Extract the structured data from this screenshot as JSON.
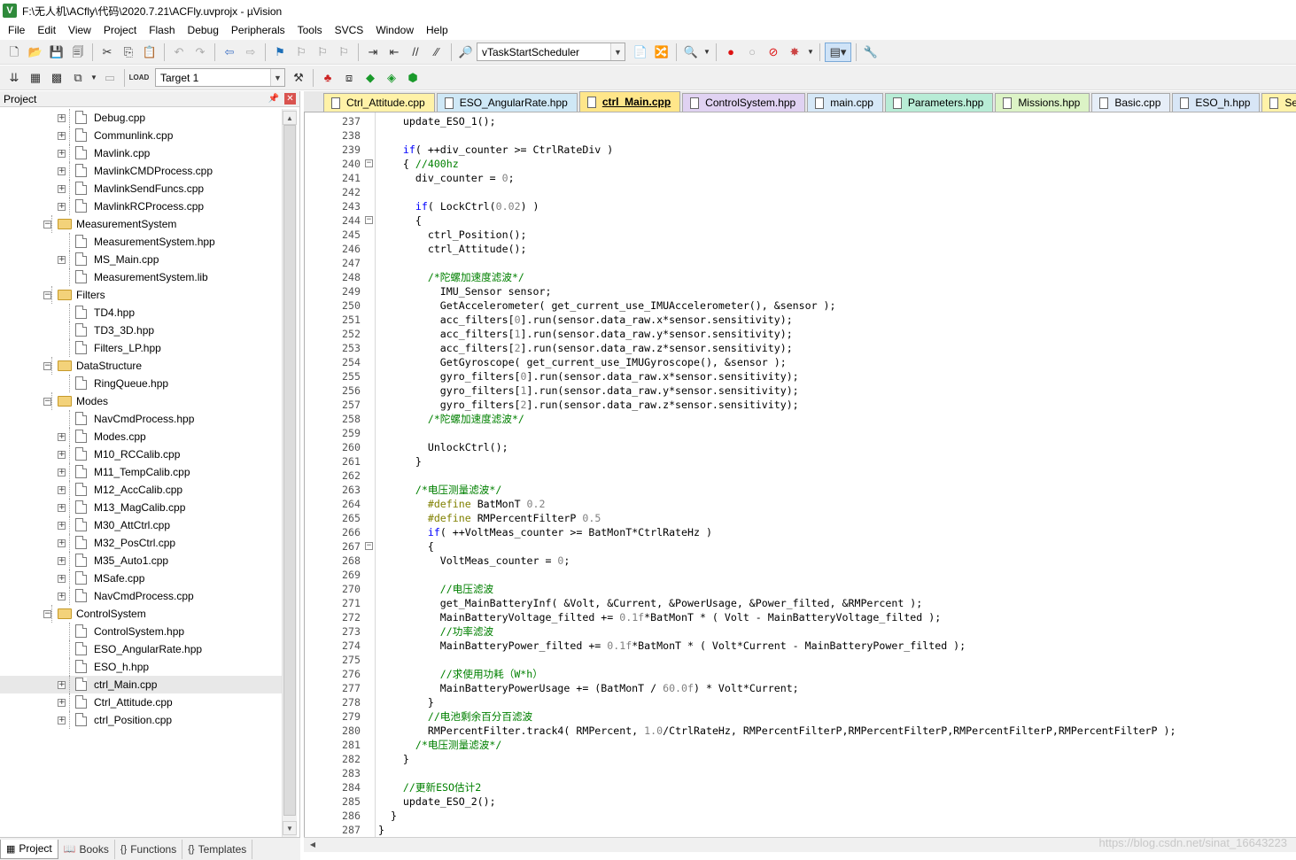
{
  "window": {
    "title": "F:\\无人机\\ACfly\\代码\\2020.7.21\\ACFly.uvprojx - µVision"
  },
  "menu": [
    "File",
    "Edit",
    "View",
    "Project",
    "Flash",
    "Debug",
    "Peripherals",
    "Tools",
    "SVCS",
    "Window",
    "Help"
  ],
  "toolbar": {
    "function_combo": "vTaskStartScheduler",
    "target_combo": "Target 1"
  },
  "project_panel": {
    "title": "Project",
    "tree": [
      {
        "label": "Debug.cpp",
        "type": "file",
        "level": 2,
        "expand": "+"
      },
      {
        "label": "Communlink.cpp",
        "type": "file",
        "level": 2,
        "expand": "+"
      },
      {
        "label": "Mavlink.cpp",
        "type": "file",
        "level": 2,
        "expand": "+"
      },
      {
        "label": "MavlinkCMDProcess.cpp",
        "type": "file",
        "level": 2,
        "expand": "+"
      },
      {
        "label": "MavlinkSendFuncs.cpp",
        "type": "file",
        "level": 2,
        "expand": "+"
      },
      {
        "label": "MavlinkRCProcess.cpp",
        "type": "file",
        "level": 2,
        "expand": "+"
      },
      {
        "label": "MeasurementSystem",
        "type": "folder",
        "level": 1,
        "expand": "-"
      },
      {
        "label": "MeasurementSystem.hpp",
        "type": "file",
        "level": 2,
        "expand": ""
      },
      {
        "label": "MS_Main.cpp",
        "type": "file",
        "level": 2,
        "expand": "+"
      },
      {
        "label": "MeasurementSystem.lib",
        "type": "file",
        "level": 2,
        "expand": ""
      },
      {
        "label": "Filters",
        "type": "folder",
        "level": 1,
        "expand": "-"
      },
      {
        "label": "TD4.hpp",
        "type": "file",
        "level": 2,
        "expand": ""
      },
      {
        "label": "TD3_3D.hpp",
        "type": "file",
        "level": 2,
        "expand": ""
      },
      {
        "label": "Filters_LP.hpp",
        "type": "file",
        "level": 2,
        "expand": ""
      },
      {
        "label": "DataStructure",
        "type": "folder",
        "level": 1,
        "expand": "-"
      },
      {
        "label": "RingQueue.hpp",
        "type": "file",
        "level": 2,
        "expand": ""
      },
      {
        "label": "Modes",
        "type": "folder",
        "level": 1,
        "expand": "-"
      },
      {
        "label": "NavCmdProcess.hpp",
        "type": "file",
        "level": 2,
        "expand": ""
      },
      {
        "label": "Modes.cpp",
        "type": "file",
        "level": 2,
        "expand": "+"
      },
      {
        "label": "M10_RCCalib.cpp",
        "type": "file",
        "level": 2,
        "expand": "+"
      },
      {
        "label": "M11_TempCalib.cpp",
        "type": "file",
        "level": 2,
        "expand": "+"
      },
      {
        "label": "M12_AccCalib.cpp",
        "type": "file",
        "level": 2,
        "expand": "+"
      },
      {
        "label": "M13_MagCalib.cpp",
        "type": "file",
        "level": 2,
        "expand": "+"
      },
      {
        "label": "M30_AttCtrl.cpp",
        "type": "file",
        "level": 2,
        "expand": "+"
      },
      {
        "label": "M32_PosCtrl.cpp",
        "type": "file",
        "level": 2,
        "expand": "+"
      },
      {
        "label": "M35_Auto1.cpp",
        "type": "file",
        "level": 2,
        "expand": "+"
      },
      {
        "label": "MSafe.cpp",
        "type": "file",
        "level": 2,
        "expand": "+"
      },
      {
        "label": "NavCmdProcess.cpp",
        "type": "file",
        "level": 2,
        "expand": "+"
      },
      {
        "label": "ControlSystem",
        "type": "folder",
        "level": 1,
        "expand": "-"
      },
      {
        "label": "ControlSystem.hpp",
        "type": "file",
        "level": 2,
        "expand": ""
      },
      {
        "label": "ESO_AngularRate.hpp",
        "type": "file",
        "level": 2,
        "expand": ""
      },
      {
        "label": "ESO_h.hpp",
        "type": "file",
        "level": 2,
        "expand": ""
      },
      {
        "label": "ctrl_Main.cpp",
        "type": "file",
        "level": 2,
        "expand": "+",
        "selected": true
      },
      {
        "label": "Ctrl_Attitude.cpp",
        "type": "file",
        "level": 2,
        "expand": "+"
      },
      {
        "label": "ctrl_Position.cpp",
        "type": "file",
        "level": 2,
        "expand": "+"
      }
    ]
  },
  "bottom_tabs": [
    {
      "label": "Project",
      "icon": "project-icon",
      "active": true
    },
    {
      "label": "Books",
      "icon": "books-icon",
      "active": false
    },
    {
      "label": "Functions",
      "icon": "functions-icon",
      "active": false
    },
    {
      "label": "Templates",
      "icon": "templates-icon",
      "active": false
    }
  ],
  "editor_tabs": [
    {
      "label": "Ctrl_Attitude.cpp",
      "color": "#fff2a8",
      "active": false
    },
    {
      "label": "ESO_AngularRate.hpp",
      "color": "#cfe8f6",
      "active": false
    },
    {
      "label": "ctrl_Main.cpp",
      "color": "#ffe68a",
      "active": true
    },
    {
      "label": "ControlSystem.hpp",
      "color": "#e0d2f2",
      "active": false
    },
    {
      "label": "main.cpp",
      "color": "#d6e8f7",
      "active": false
    },
    {
      "label": "Parameters.hpp",
      "color": "#b8ecd6",
      "active": false
    },
    {
      "label": "Missions.hpp",
      "color": "#dcf3c6",
      "active": false
    },
    {
      "label": "Basic.cpp",
      "color": "#e6eef8",
      "active": false
    },
    {
      "label": "ESO_h.hpp",
      "color": "#d8e6f6",
      "active": false
    },
    {
      "label": "Ser",
      "color": "#fff2a8",
      "active": false
    }
  ],
  "code": [
    {
      "n": "237",
      "fold": "",
      "s": [
        [
          "",
          "    update_ESO_1();"
        ]
      ]
    },
    {
      "n": "238",
      "fold": "",
      "s": []
    },
    {
      "n": "239",
      "fold": "",
      "s": [
        [
          "",
          "    "
        ],
        [
          "kw",
          "if"
        ],
        [
          "",
          "( ++div_counter >= CtrlRateDiv )"
        ]
      ]
    },
    {
      "n": "240",
      "fold": "-",
      "s": [
        [
          "",
          "    { "
        ],
        [
          "cm",
          "//400hz"
        ]
      ]
    },
    {
      "n": "241",
      "fold": "",
      "s": [
        [
          "",
          "      div_counter = "
        ],
        [
          "nm",
          "0"
        ],
        [
          "",
          ";"
        ]
      ]
    },
    {
      "n": "242",
      "fold": "",
      "s": []
    },
    {
      "n": "243",
      "fold": "",
      "s": [
        [
          "",
          "      "
        ],
        [
          "kw",
          "if"
        ],
        [
          "",
          "( LockCtrl("
        ],
        [
          "nm",
          "0.02"
        ],
        [
          "",
          ") )"
        ]
      ]
    },
    {
      "n": "244",
      "fold": "-",
      "s": [
        [
          "",
          "      {"
        ]
      ]
    },
    {
      "n": "245",
      "fold": "",
      "s": [
        [
          "",
          "        ctrl_Position();"
        ]
      ]
    },
    {
      "n": "246",
      "fold": "",
      "s": [
        [
          "",
          "        ctrl_Attitude();"
        ]
      ]
    },
    {
      "n": "247",
      "fold": "",
      "s": []
    },
    {
      "n": "248",
      "fold": "",
      "s": [
        [
          "cm",
          "        /*陀螺加速度滤波*/"
        ]
      ]
    },
    {
      "n": "249",
      "fold": "",
      "s": [
        [
          "",
          "          IMU_Sensor sensor;"
        ]
      ]
    },
    {
      "n": "250",
      "fold": "",
      "s": [
        [
          "",
          "          GetAccelerometer( get_current_use_IMUAccelerometer(), &sensor );"
        ]
      ]
    },
    {
      "n": "251",
      "fold": "",
      "s": [
        [
          "",
          "          acc_filters["
        ],
        [
          "nm",
          "0"
        ],
        [
          "",
          "].run(sensor.data_raw.x*sensor.sensitivity);"
        ]
      ]
    },
    {
      "n": "252",
      "fold": "",
      "s": [
        [
          "",
          "          acc_filters["
        ],
        [
          "nm",
          "1"
        ],
        [
          "",
          "].run(sensor.data_raw.y*sensor.sensitivity);"
        ]
      ]
    },
    {
      "n": "253",
      "fold": "",
      "s": [
        [
          "",
          "          acc_filters["
        ],
        [
          "nm",
          "2"
        ],
        [
          "",
          "].run(sensor.data_raw.z*sensor.sensitivity);"
        ]
      ]
    },
    {
      "n": "254",
      "fold": "",
      "s": [
        [
          "",
          "          GetGyroscope( get_current_use_IMUGyroscope(), &sensor );"
        ]
      ]
    },
    {
      "n": "255",
      "fold": "",
      "s": [
        [
          "",
          "          gyro_filters["
        ],
        [
          "nm",
          "0"
        ],
        [
          "",
          "].run(sensor.data_raw.x*sensor.sensitivity);"
        ]
      ]
    },
    {
      "n": "256",
      "fold": "",
      "s": [
        [
          "",
          "          gyro_filters["
        ],
        [
          "nm",
          "1"
        ],
        [
          "",
          "].run(sensor.data_raw.y*sensor.sensitivity);"
        ]
      ]
    },
    {
      "n": "257",
      "fold": "",
      "s": [
        [
          "",
          "          gyro_filters["
        ],
        [
          "nm",
          "2"
        ],
        [
          "",
          "].run(sensor.data_raw.z*sensor.sensitivity);"
        ]
      ]
    },
    {
      "n": "258",
      "fold": "",
      "s": [
        [
          "cm",
          "        /*陀螺加速度滤波*/"
        ]
      ]
    },
    {
      "n": "259",
      "fold": "",
      "s": []
    },
    {
      "n": "260",
      "fold": "",
      "s": [
        [
          "",
          "        UnlockCtrl();"
        ]
      ]
    },
    {
      "n": "261",
      "fold": "",
      "s": [
        [
          "",
          "      }"
        ]
      ]
    },
    {
      "n": "262",
      "fold": "",
      "s": []
    },
    {
      "n": "263",
      "fold": "",
      "s": [
        [
          "cm",
          "      /*电压测量滤波*/"
        ]
      ]
    },
    {
      "n": "264",
      "fold": "",
      "s": [
        [
          "",
          "        "
        ],
        [
          "pp",
          "#define"
        ],
        [
          "",
          " BatMonT "
        ],
        [
          "nm",
          "0.2"
        ]
      ]
    },
    {
      "n": "265",
      "fold": "",
      "s": [
        [
          "",
          "        "
        ],
        [
          "pp",
          "#define"
        ],
        [
          "",
          " RMPercentFilterP "
        ],
        [
          "nm",
          "0.5"
        ]
      ]
    },
    {
      "n": "266",
      "fold": "",
      "s": [
        [
          "",
          "        "
        ],
        [
          "kw",
          "if"
        ],
        [
          "",
          "( ++VoltMeas_counter >= BatMonT*CtrlRateHz )"
        ]
      ]
    },
    {
      "n": "267",
      "fold": "-",
      "s": [
        [
          "",
          "        {"
        ]
      ]
    },
    {
      "n": "268",
      "fold": "",
      "s": [
        [
          "",
          "          VoltMeas_counter = "
        ],
        [
          "nm",
          "0"
        ],
        [
          "",
          ";"
        ]
      ]
    },
    {
      "n": "269",
      "fold": "",
      "s": []
    },
    {
      "n": "270",
      "fold": "",
      "s": [
        [
          "cm",
          "          //电压滤波"
        ]
      ]
    },
    {
      "n": "271",
      "fold": "",
      "s": [
        [
          "",
          "          get_MainBatteryInf( &Volt, &Current, &PowerUsage, &Power_filted, &RMPercent );"
        ]
      ]
    },
    {
      "n": "272",
      "fold": "",
      "s": [
        [
          "",
          "          MainBatteryVoltage_filted += "
        ],
        [
          "nm",
          "0.1f"
        ],
        [
          "",
          "*BatMonT * ( Volt - MainBatteryVoltage_filted );"
        ]
      ]
    },
    {
      "n": "273",
      "fold": "",
      "s": [
        [
          "cm",
          "          //功率滤波"
        ]
      ]
    },
    {
      "n": "274",
      "fold": "",
      "s": [
        [
          "",
          "          MainBatteryPower_filted += "
        ],
        [
          "nm",
          "0.1f"
        ],
        [
          "",
          "*BatMonT * ( Volt*Current - MainBatteryPower_filted );"
        ]
      ]
    },
    {
      "n": "275",
      "fold": "",
      "s": []
    },
    {
      "n": "276",
      "fold": "",
      "s": [
        [
          "cm",
          "          //求使用功耗（W*h）"
        ]
      ]
    },
    {
      "n": "277",
      "fold": "",
      "s": [
        [
          "",
          "          MainBatteryPowerUsage += (BatMonT / "
        ],
        [
          "nm",
          "60.0f"
        ],
        [
          "",
          ") * Volt*Current;"
        ]
      ]
    },
    {
      "n": "278",
      "fold": "",
      "s": [
        [
          "",
          "        }"
        ]
      ]
    },
    {
      "n": "279",
      "fold": "",
      "s": [
        [
          "cm",
          "        //电池剩余百分百滤波"
        ]
      ]
    },
    {
      "n": "280",
      "fold": "",
      "s": [
        [
          "",
          "        RMPercentFilter.track4( RMPercent, "
        ],
        [
          "nm",
          "1.0"
        ],
        [
          "",
          "/CtrlRateHz, RMPercentFilterP,RMPercentFilterP,RMPercentFilterP,RMPercentFilterP );"
        ]
      ]
    },
    {
      "n": "281",
      "fold": "",
      "s": [
        [
          "cm",
          "      /*电压测量滤波*/"
        ]
      ]
    },
    {
      "n": "282",
      "fold": "",
      "s": [
        [
          "",
          "    }"
        ]
      ]
    },
    {
      "n": "283",
      "fold": "",
      "s": []
    },
    {
      "n": "284",
      "fold": "",
      "s": [
        [
          "cm",
          "    //更新ESO估计2"
        ]
      ]
    },
    {
      "n": "285",
      "fold": "",
      "s": [
        [
          "",
          "    update_ESO_2();"
        ]
      ]
    },
    {
      "n": "286",
      "fold": "",
      "s": [
        [
          "",
          "  }"
        ]
      ]
    },
    {
      "n": "287",
      "fold": "",
      "s": [
        [
          "",
          "}"
        ]
      ]
    }
  ],
  "watermark": "https://blog.csdn.net/sinat_16643223"
}
